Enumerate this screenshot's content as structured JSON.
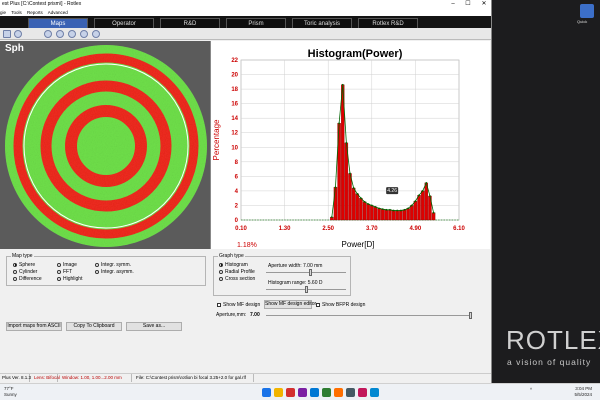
{
  "window": {
    "title": "est Plus [C:\\Contest prism\\] - Rotlex",
    "controls": [
      "–",
      "☐",
      "✕"
    ]
  },
  "menu": [
    "gie",
    "Tools",
    "Reports",
    "Advanced"
  ],
  "tabs": [
    {
      "label": "Maps",
      "active": true
    },
    {
      "label": "Operator",
      "active": false
    },
    {
      "label": "R&D",
      "active": false
    },
    {
      "label": "Prism",
      "active": false
    },
    {
      "label": "Toric analysis",
      "active": false
    },
    {
      "label": "Rotlex R&D",
      "active": false
    }
  ],
  "toolbar": {
    "icons": [
      "tool-icon",
      "add-icon",
      "zoom-icon",
      "grid-icon",
      "view-icon",
      "settings-icon",
      "info-icon"
    ]
  },
  "map": {
    "label": "Sph",
    "colors": {
      "bg": "#5b5b5b",
      "green": "#6fe04a",
      "red": "#ef2a20",
      "circle": "#ffffff"
    }
  },
  "histogram": {
    "marker_label": "4.26",
    "percent_note": "1.18%"
  },
  "chart_data": {
    "type": "bar",
    "title": "Histogram(Power)",
    "xlabel": "Power[D]",
    "ylabel": "Percentage",
    "xlim": [
      0.1,
      6.1
    ],
    "ylim": [
      0,
      22
    ],
    "xticks": [
      "0.10",
      "1.30",
      "2.50",
      "3.70",
      "4.90",
      "6.10"
    ],
    "yticks": [
      "0",
      "2",
      "4",
      "6",
      "8",
      "10",
      "12",
      "14",
      "16",
      "18",
      "20",
      "22"
    ],
    "grid": true,
    "bar_color": "#dd0000",
    "line_color": "#006400",
    "x": [
      2.6,
      2.7,
      2.8,
      2.9,
      3.0,
      3.1,
      3.2,
      3.3,
      3.4,
      3.5,
      3.6,
      3.7,
      3.8,
      3.9,
      4.0,
      4.1,
      4.2,
      4.3,
      4.4,
      4.5,
      4.6,
      4.7,
      4.8,
      4.9,
      5.0,
      5.1,
      5.2,
      5.3,
      5.4
    ],
    "values": [
      0.4,
      4.5,
      13.3,
      18.6,
      10.6,
      6.4,
      4.4,
      3.6,
      3.0,
      2.5,
      2.2,
      2.0,
      1.8,
      1.6,
      1.5,
      1.4,
      1.4,
      1.3,
      1.3,
      1.3,
      1.4,
      1.6,
      2.0,
      2.6,
      3.4,
      4.0,
      5.1,
      3.3,
      1.0
    ],
    "annotation": {
      "x": 4.26,
      "label": "4.26"
    }
  },
  "map_type": {
    "title": "Map type",
    "col1": [
      {
        "label": "Sphere",
        "selected": true
      },
      {
        "label": "Cylinder",
        "selected": false
      },
      {
        "label": "Difference",
        "selected": false
      }
    ],
    "col2": [
      {
        "label": "Image",
        "selected": false
      },
      {
        "label": "FFT",
        "selected": false
      },
      {
        "label": "Highlight",
        "selected": false
      }
    ],
    "col3": [
      {
        "label": "Integr. symm.",
        "selected": false
      },
      {
        "label": "Integr. asymm.",
        "selected": false
      }
    ]
  },
  "graph_type": {
    "title": "Graph type",
    "options": [
      {
        "label": "Histogram",
        "selected": true
      },
      {
        "label": "Radial Profile",
        "selected": false
      },
      {
        "label": "Cross section",
        "selected": false
      }
    ],
    "aperture_label": "Aperture width: 7.00 mm",
    "aperture_value": 0.55,
    "range_label": "Histogram range: 5.60 D",
    "range_value": 0.5
  },
  "design": {
    "show_mf_label": "Show MF design",
    "show_mf_editor": "Show MF design editor",
    "show_bfpr_label": "Show BFPR design",
    "aperture_mm_label": "Aperture,mm:",
    "aperture_mm_value": "7.00",
    "aperture_slider_value": 1.0
  },
  "buttons": {
    "import": "Import maps from ASCII",
    "copy": "Copy To Clipboard",
    "save": "Save as..."
  },
  "statusbar": {
    "version": "Plus Ver. 8.1.3",
    "lens": "Lens: Bifocal",
    "window": "Window: 1.00, 1.00...2.00 mm",
    "file": "File: C:\\Contest prism\\rotlion bi focal 3.25+2.0 for gal.rlf"
  },
  "desktop": {
    "brand": "ROTLEX",
    "tagline": "a vision of quality",
    "icon_label": "Quick"
  },
  "taskbar": {
    "weather_line1": "77°F",
    "weather_line2": "Sunny",
    "tray": "^",
    "time": "3:04 PM",
    "date": "5/5/2024",
    "app_icon_colors": [
      "#1a73e8",
      "#f2b400",
      "#d32f2f",
      "#7b1fa2",
      "#0078d4",
      "#2e7d32",
      "#ff6f00",
      "#455a64",
      "#c2185b",
      "#0288d1"
    ]
  }
}
